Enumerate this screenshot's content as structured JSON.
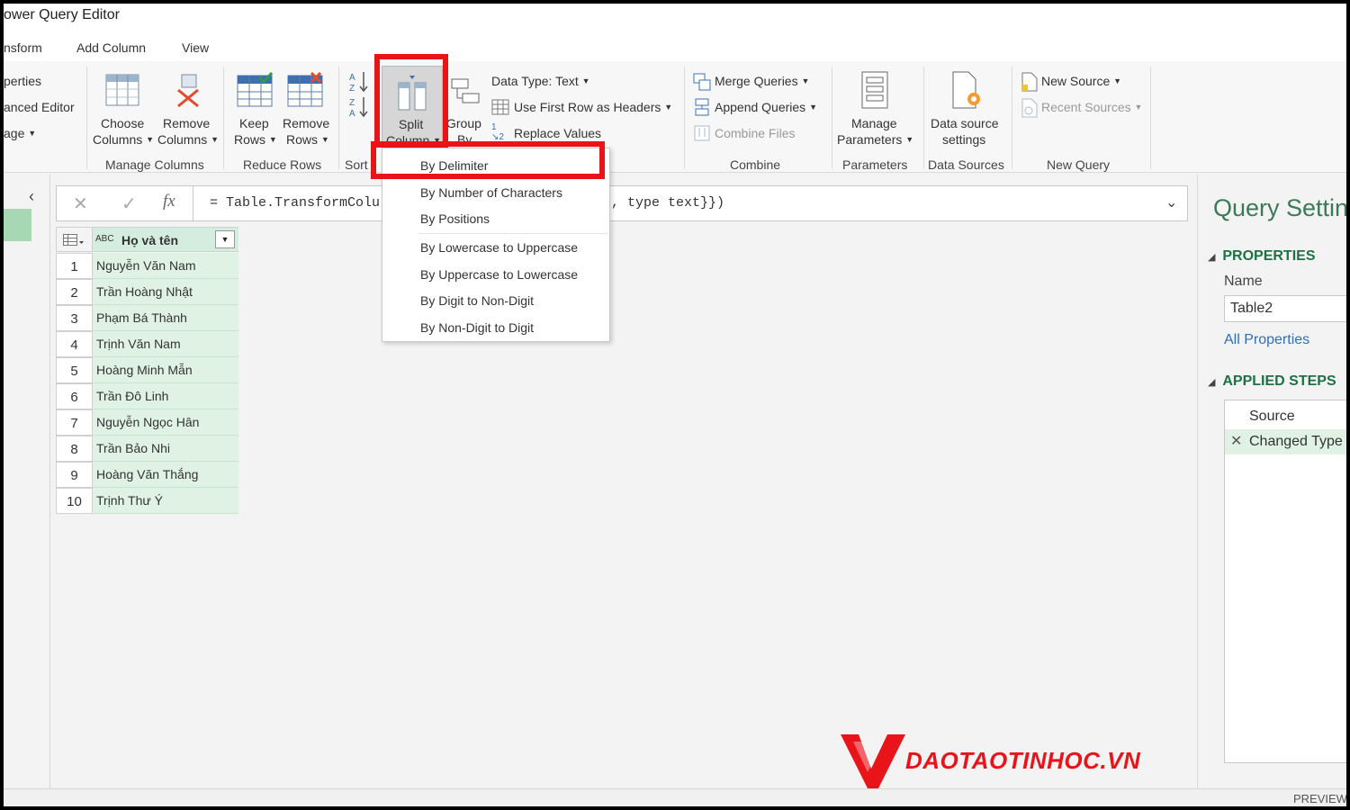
{
  "app": {
    "title": "ower Query Editor"
  },
  "menu": {
    "tabs": [
      "nsform",
      "Add Column",
      "View"
    ]
  },
  "ribbon": {
    "left_partial": {
      "properties": "perties",
      "advanced_editor": "anced Editor",
      "manage": "age"
    },
    "choose_columns": {
      "line1": "Choose",
      "line2": "Columns"
    },
    "remove_columns": {
      "line1": "Remove",
      "line2": "Columns"
    },
    "manage_columns_label": "Manage Columns",
    "keep_rows": {
      "line1": "Keep",
      "line2": "Rows"
    },
    "remove_rows": {
      "line1": "Remove",
      "line2": "Rows"
    },
    "reduce_rows_label": "Reduce Rows",
    "sort_label": "Sort",
    "split_column": {
      "line1": "Split",
      "line2": "Column"
    },
    "group_by": {
      "line1": "Group",
      "line2": "By"
    },
    "data_type": "Data Type: Text",
    "use_first_row": "Use First Row as Headers",
    "replace_values": "Replace Values",
    "merge_queries": "Merge Queries",
    "append_queries": "Append Queries",
    "combine_files": "Combine Files",
    "combine_label": "Combine",
    "manage_parameters": {
      "line1": "Manage",
      "line2": "Parameters"
    },
    "parameters_label": "Parameters",
    "data_source_settings": {
      "line1": "Data source",
      "line2": "settings"
    },
    "data_sources_label": "Data Sources",
    "new_source": "New Source",
    "recent_sources": "Recent Sources",
    "new_query_label": "New Query"
  },
  "split_menu": {
    "items": [
      "By Delimiter",
      "By Number of Characters",
      "By Positions",
      "By Lowercase to Uppercase",
      "By Uppercase to Lowercase",
      "By Digit to Non-Digit",
      "By Non-Digit to Digit"
    ]
  },
  "formula_bar": {
    "cancel": "✕",
    "confirm": "✓",
    "fx": "fx",
    "text_left": "= Table.TransformColu",
    "text_right": ", type text}})"
  },
  "table": {
    "type_icon": "ABC",
    "column_header": "Họ và tên",
    "rows": [
      {
        "n": "1",
        "name": "Nguyễn Văn Nam"
      },
      {
        "n": "2",
        "name": "Trần Hoàng Nhật"
      },
      {
        "n": "3",
        "name": "Phạm Bá Thành"
      },
      {
        "n": "4",
        "name": "Trịnh Văn Nam"
      },
      {
        "n": "5",
        "name": "Hoàng Minh Mẫn"
      },
      {
        "n": "6",
        "name": "Trần Đô Linh"
      },
      {
        "n": "7",
        "name": "Nguyễn Ngọc Hân"
      },
      {
        "n": "8",
        "name": "Trần Bảo Nhi"
      },
      {
        "n": "9",
        "name": "Hoàng Văn Thắng"
      },
      {
        "n": "10",
        "name": "Trịnh Thư Ý"
      }
    ]
  },
  "query_settings": {
    "title": "Query Setting",
    "properties_header": "PROPERTIES",
    "name_label": "Name",
    "name_value": "Table2",
    "all_properties": "All Properties",
    "applied_steps_header": "APPLIED STEPS",
    "steps": [
      "Source",
      "Changed Type"
    ]
  },
  "watermark": {
    "text": "DAOTAOTINHOC.VN"
  },
  "status": {
    "preview": "PREVIEW"
  },
  "colors": {
    "accent_green": "#1e7145",
    "highlight_red": "#e8141a",
    "selected_row": "#dff2e4"
  }
}
